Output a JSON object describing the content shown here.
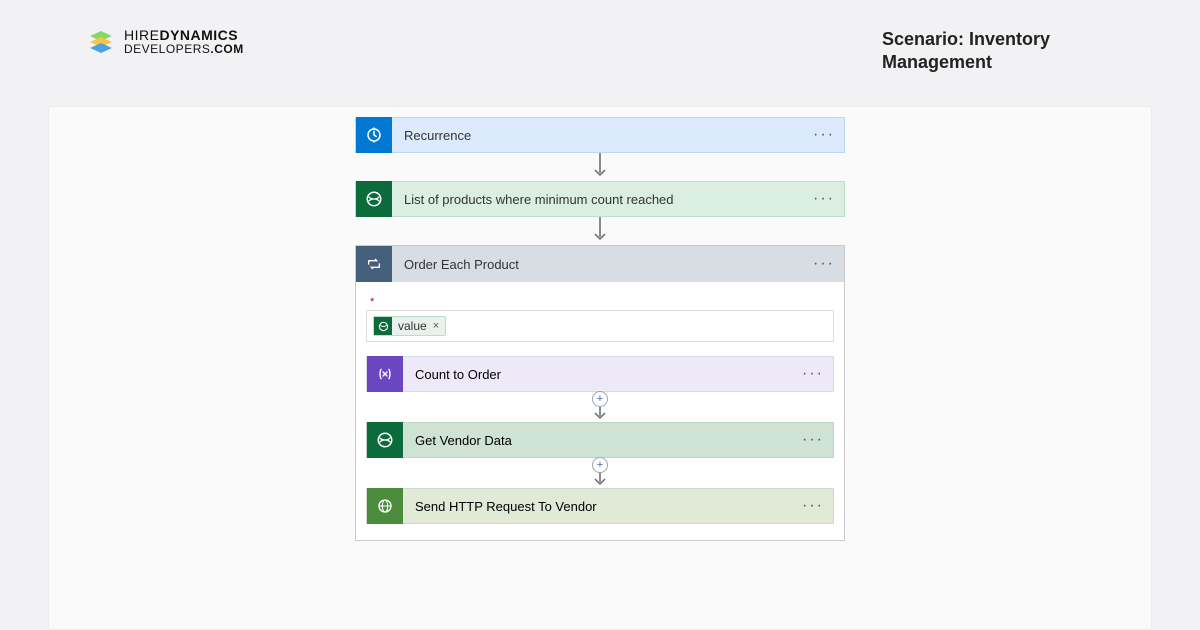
{
  "brand": {
    "line1_a": "HIRE",
    "line1_b": "DYNAMICS",
    "line2_a": "DEVELOPERS",
    "line2_b": ".COM"
  },
  "scenario_title": "Scenario: Inventory Management",
  "flow": {
    "recurrence": {
      "label": "Recurrence"
    },
    "list_products": {
      "label": "List of products where minimum count reached"
    },
    "loop": {
      "title": "Order Each Product",
      "token": {
        "label": "value"
      },
      "count_to_order": {
        "label": "Count to Order"
      },
      "get_vendor": {
        "label": "Get Vendor Data"
      },
      "send_http": {
        "label": "Send HTTP Request To Vendor"
      }
    }
  },
  "ellipsis": "···",
  "plus": "+"
}
